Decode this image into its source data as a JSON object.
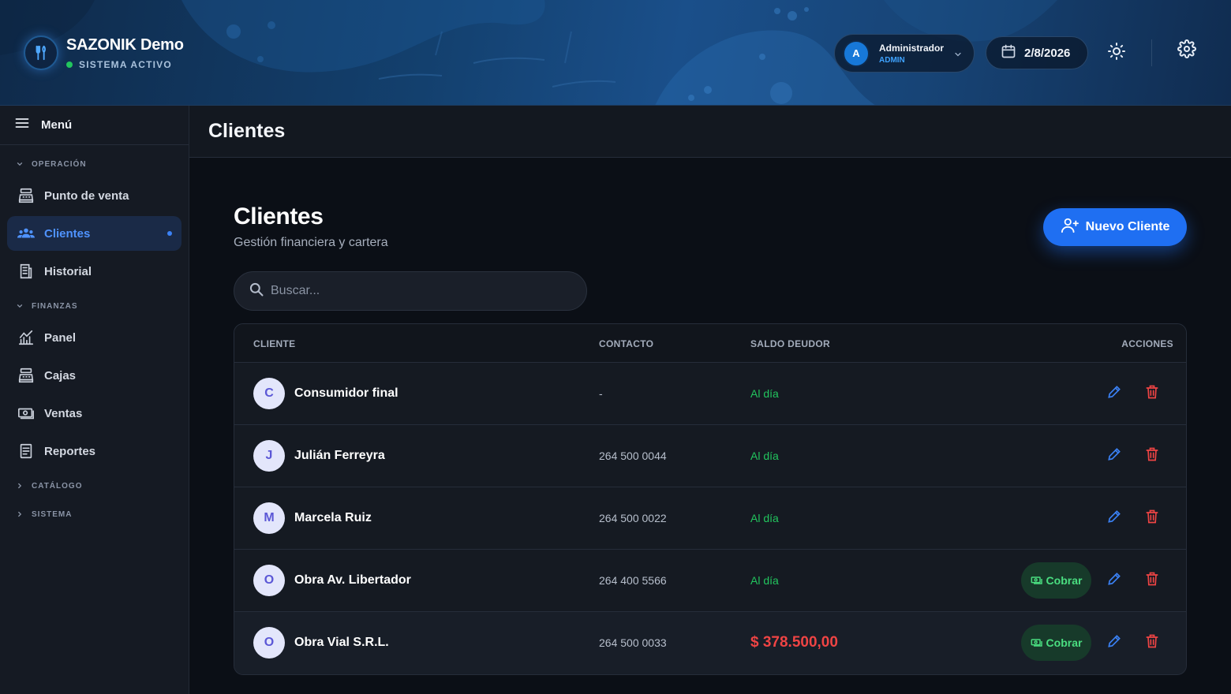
{
  "header": {
    "brand_title": "SAZONIK Demo",
    "brand_status": "SISTEMA ACTIVO",
    "user": {
      "initial": "A",
      "name": "Administrador",
      "role": "ADMIN"
    },
    "date": "2/8/2026",
    "icons": [
      "utensils-icon",
      "chevron-down-icon",
      "calendar-icon",
      "sun-icon",
      "gear-icon"
    ]
  },
  "sidebar": {
    "menu_label": "Menú",
    "sections": {
      "operacion": "OPERACIÓN",
      "finanzas": "FINANZAS",
      "catalogo": "CATÁLOGO",
      "sistema": "SISTEMA"
    },
    "items": {
      "punto_de_venta": "Punto de venta",
      "clientes": "Clientes",
      "historial": "Historial",
      "panel": "Panel",
      "cajas": "Cajas",
      "ventas": "Ventas",
      "reportes": "Reportes"
    }
  },
  "topbar": {
    "title": "Clientes"
  },
  "page": {
    "title": "Clientes",
    "subtitle": "Gestión financiera y cartera",
    "new_button": "Nuevo Cliente",
    "search_placeholder": "Buscar..."
  },
  "table": {
    "columns": {
      "cliente": "CLIENTE",
      "contacto": "CONTACTO",
      "saldo": "SALDO DEUDOR",
      "acciones": "ACCIONES"
    },
    "cobrar_label": "Cobrar",
    "rows": [
      {
        "initial": "C",
        "name": "Consumidor final",
        "contact": "-",
        "saldo": "Al día"
      },
      {
        "initial": "J",
        "name": "Julián Ferreyra",
        "contact": "264 500 0044",
        "saldo": "Al día"
      },
      {
        "initial": "M",
        "name": "Marcela Ruiz",
        "contact": "264 500 0022",
        "saldo": "Al día"
      },
      {
        "initial": "O",
        "name": "Obra Av. Libertador",
        "contact": "264 400 5566",
        "saldo": "Al día"
      },
      {
        "initial": "O",
        "name": "Obra Vial S.R.L.",
        "contact": "264 500 0033",
        "saldo": "$ 378.500,00"
      }
    ]
  },
  "colors": {
    "accent": "#1f6ff2",
    "ok": "#22c55e",
    "debt": "#ef4444",
    "edit": "#3b82f6",
    "delete": "#ef4444"
  }
}
